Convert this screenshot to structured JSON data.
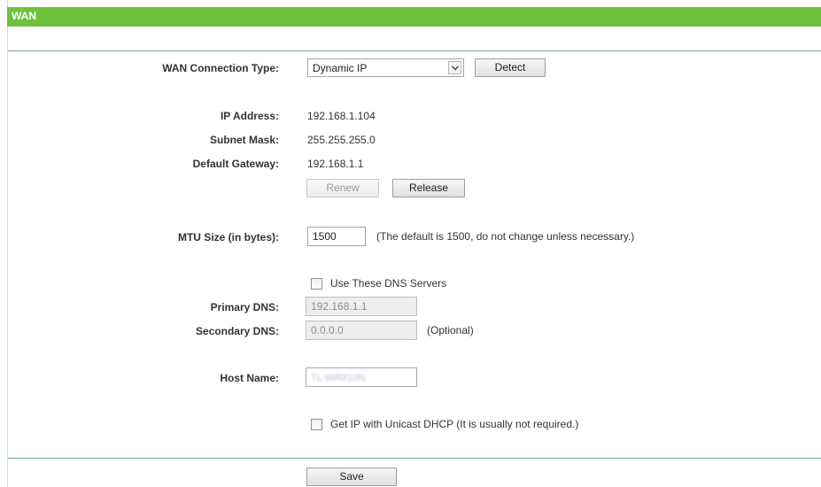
{
  "title": "WAN",
  "connection_type": {
    "label": "WAN Connection Type:",
    "selected": "Dynamic IP",
    "detect_label": "Detect"
  },
  "ip_info": {
    "ip_label": "IP Address:",
    "ip_value": "192.168.1.104",
    "mask_label": "Subnet Mask:",
    "mask_value": "255.255.255.0",
    "gateway_label": "Default Gateway:",
    "gateway_value": "192.168.1.1",
    "renew_label": "Renew",
    "release_label": "Release"
  },
  "mtu": {
    "label": "MTU Size (in bytes):",
    "value": "1500",
    "hint": "(The default is 1500, do not change unless necessary.)"
  },
  "dns": {
    "checkbox_label": "Use These DNS Servers",
    "checked": false,
    "primary_label": "Primary DNS:",
    "primary_value": "192.168.1.1",
    "secondary_label": "Secondary DNS:",
    "secondary_value": "0.0.0.0",
    "optional_hint": "(Optional)"
  },
  "host": {
    "label": "Host Name:",
    "value": "TL-WR810N"
  },
  "unicast": {
    "checkbox_label": "Get IP with Unicast DHCP (It is usually not required.)",
    "checked": false
  },
  "save_label": "Save",
  "colors": {
    "title_bar": "#6ec23e",
    "rule": "#6fa886"
  }
}
